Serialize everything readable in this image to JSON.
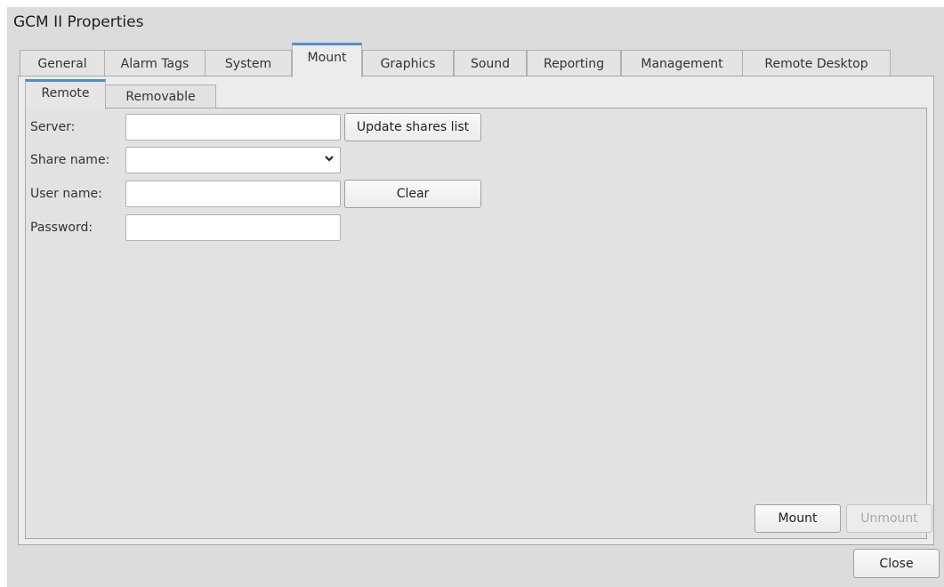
{
  "window": {
    "title": "GCM II Properties"
  },
  "tabs": [
    {
      "label": "General"
    },
    {
      "label": "Alarm Tags"
    },
    {
      "label": "System"
    },
    {
      "label": "Mount"
    },
    {
      "label": "Graphics"
    },
    {
      "label": "Sound"
    },
    {
      "label": "Reporting"
    },
    {
      "label": "Management"
    },
    {
      "label": "Remote Desktop"
    }
  ],
  "active_tab": "Mount",
  "sub_tabs": [
    {
      "label": "Remote"
    },
    {
      "label": "Removable"
    }
  ],
  "active_sub_tab": "Remote",
  "form": {
    "server_label": "Server:",
    "server_value": "",
    "share_label": "Share name:",
    "share_value": "",
    "user_label": "User name:",
    "user_value": "",
    "password_label": "Password:",
    "password_value": "",
    "update_button": "Update shares list",
    "clear_button": "Clear"
  },
  "actions": {
    "mount": "Mount",
    "unmount": "Unmount",
    "close": "Close"
  },
  "icons": {
    "share_dropdown": "chevron-down-icon"
  },
  "colors": {
    "active_tab_accent": "#4b8fd1",
    "background": "#dcdcdc"
  }
}
